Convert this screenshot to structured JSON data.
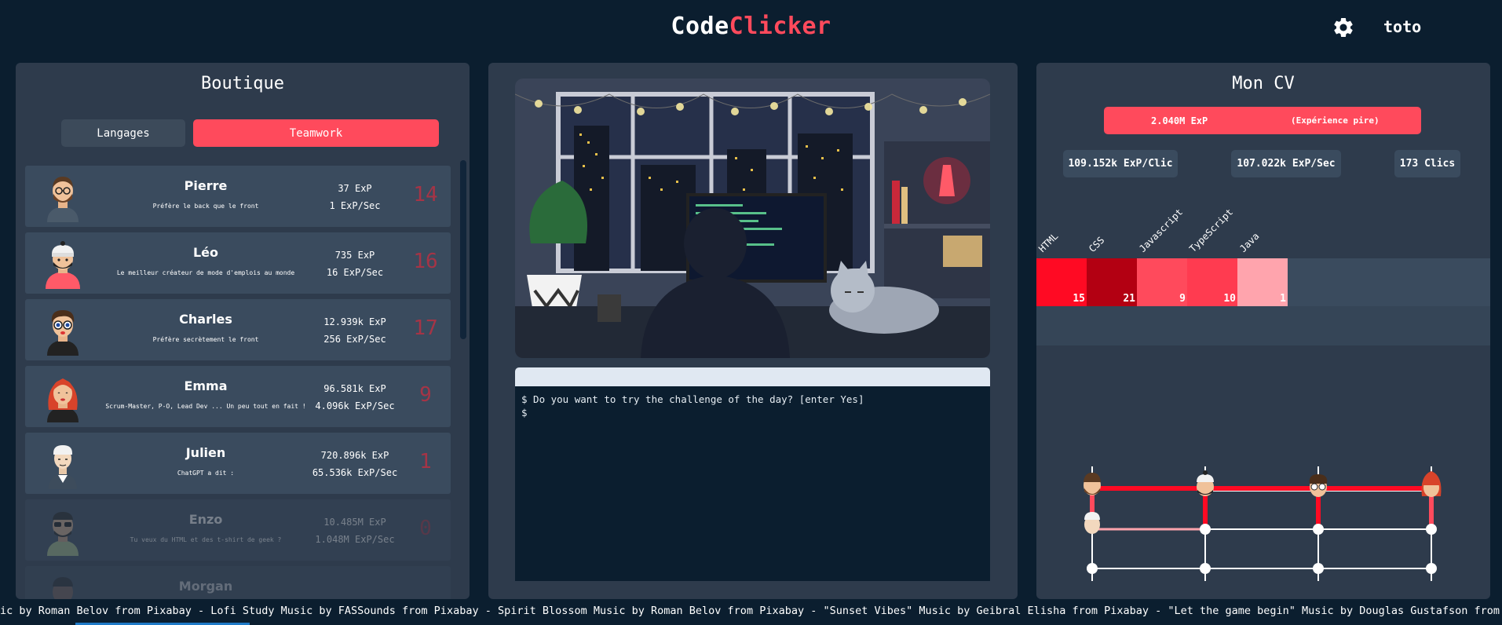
{
  "header": {
    "logo_code": "Code",
    "logo_clicker": "Clicker",
    "username": "toto",
    "settings_icon": "gear-icon"
  },
  "shop": {
    "title": "Boutique",
    "tabs": [
      {
        "label": "Langages",
        "active": false
      },
      {
        "label": "Teamwork",
        "active": true
      }
    ],
    "items": [
      {
        "name": "Pierre",
        "desc": "Préfère le back que le front",
        "exp": "37 ExP",
        "rate": "1 ExP/Sec",
        "count": "14",
        "locked": false
      },
      {
        "name": "Léo",
        "desc": "Le meilleur créateur de mode d'emplois au monde",
        "exp": "735 ExP",
        "rate": "16 ExP/Sec",
        "count": "16",
        "locked": false
      },
      {
        "name": "Charles",
        "desc": "Préfère secrètement le front",
        "exp": "12.939k ExP",
        "rate": "256 ExP/Sec",
        "count": "17",
        "locked": false
      },
      {
        "name": "Emma",
        "desc": "Scrum-Master, P-O, Lead Dev ... Un peu tout en fait !",
        "exp": "96.581k ExP",
        "rate": "4.096k ExP/Sec",
        "count": "9",
        "locked": false
      },
      {
        "name": "Julien",
        "desc": "ChatGPT a dit :",
        "exp": "720.896k ExP",
        "rate": "65.536k ExP/Sec",
        "count": "1",
        "locked": false
      },
      {
        "name": "Enzo",
        "desc": "Tu veux du HTML et des t-shirt de geek ?",
        "exp": "10.485M ExP",
        "rate": "1.048M ExP/Sec",
        "count": "0",
        "locked": true
      },
      {
        "name": "Morgan",
        "desc": "",
        "exp": "",
        "rate": "",
        "count": "",
        "locked": true
      }
    ]
  },
  "terminal": {
    "lines": [
      "$ Do you want to try the challenge of the day? [enter Yes]",
      "$"
    ]
  },
  "cv": {
    "title": "Mon CV",
    "exp_value": "2.040M ExP",
    "exp_note": "(Expérience pire)",
    "stat_clic": "109.152k ExP/Clic",
    "stat_sec": "107.022k ExP/Sec",
    "stat_clics": "173 Clics",
    "languages": [
      {
        "name": "HTML",
        "value": "15",
        "color": "#ff0a23"
      },
      {
        "name": "CSS",
        "value": "21",
        "color": "#b30012"
      },
      {
        "name": "Javascript",
        "value": "9",
        "color": "#ff4a5c"
      },
      {
        "name": "TypeScript",
        "value": "10",
        "color": "#ff3b50"
      },
      {
        "name": "Java",
        "value": "1",
        "color": "#ffa4ad"
      }
    ]
  },
  "footer": {
    "ticker": "ic by Roman Belov from Pixabay - Lofi Study Music by FASSounds from Pixabay - Spirit Blossom Music by Roman Belov from Pixabay - \"Sunset Vibes\" Music by Geibral Elisha from Pixabay - \"Let the game begin\" Music by Douglas Gustafson from Pixabay - \"Cy"
  },
  "colors": {
    "accent": "#ff4a5c",
    "background": "#0b1e2f",
    "panel": "#2e3b4c"
  }
}
